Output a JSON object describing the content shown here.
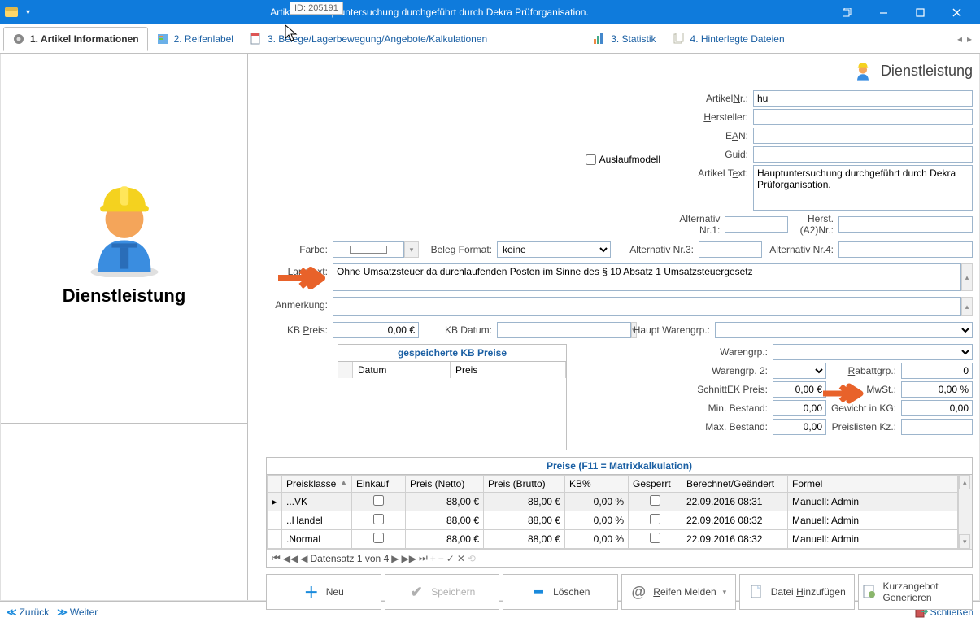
{
  "window": {
    "title": "Artikel hu Hauptuntersuchung durchgeführt durch Dekra Prüforganisation."
  },
  "tabs": {
    "t1": "1. Artikel Informationen",
    "t2": "2. Reifenlabel",
    "t3": "3. Belege/Lagerbewegung/Angebote/Kalkulationen",
    "t4": "3. Statistik",
    "t5": "4. Hinterlegte Dateien"
  },
  "left": {
    "id_label": "ID: 205191",
    "caption": "Dienstleistung"
  },
  "head": {
    "title": "Dienstleistung"
  },
  "labels": {
    "artikelnr": "ArtikelNr.:",
    "hersteller": "Hersteller:",
    "ean": "EAN:",
    "guid": "Guid:",
    "auslauf": "Auslaufmodell",
    "artikeltext": "Artikel Text:",
    "alt1": "Alternativ Nr.1:",
    "herstA2": "Herst. (A2)Nr.:",
    "farbe": "Farbe:",
    "belegformat": "Beleg Format:",
    "alt3": "Alternativ Nr.3:",
    "alt4": "Alternativ Nr.4:",
    "langtext": "Langtext:",
    "anmerkung": "Anmerkung:",
    "kbpreis": "KB Preis:",
    "kbdatum": "KB Datum:",
    "hauptwg": "Haupt Warengrp.:",
    "kbtable": "gespeicherte KB Preise",
    "kb_datum": "Datum",
    "kb_preis": "Preis",
    "wg": "Warengrp.:",
    "wg2": "Warengrp. 2:",
    "rabattgrp": "Rabattgrp.:",
    "schnittek": "SchnittEK Preis:",
    "mwst": "MwSt.:",
    "minbest": "Min. Bestand:",
    "gewicht": "Gewicht in KG:",
    "maxbest": "Max. Bestand:",
    "preislisten": "Preislisten Kz.:",
    "pricehead": "Preise (F11 = Matrixkalkulation)",
    "col_pk": "Preisklasse",
    "col_ek": "Einkauf",
    "col_pn": "Preis (Netto)",
    "col_pb": "Preis (Brutto)",
    "col_kb": "KB%",
    "col_ges": "Gesperrt",
    "col_bg": "Berechnet/Geändert",
    "col_f": "Formel",
    "gridinfo": "Datensatz 1 von 4"
  },
  "values": {
    "artikelnr": "hu",
    "hersteller": "",
    "ean": "",
    "guid": "",
    "artikeltext": "Hauptuntersuchung durchgeführt durch Dekra Prüforganisation.",
    "alt1": "",
    "herstA2": "",
    "belegformat": "keine",
    "alt3": "",
    "alt4": "",
    "langtext": "Ohne Umsatzsteuer da durchlaufenden Posten im Sinne des § 10 Absatz 1 Umsatzsteuergesetz",
    "anmerkung": "",
    "kbpreis": "0,00 €",
    "kbdatum": "",
    "hauptwg": "",
    "wg": "",
    "wg2": "",
    "rabattgrp": "0",
    "schnittek": "0,00 €",
    "mwst": "0,00 %",
    "minbest": "0,00",
    "gewicht": "0,00",
    "maxbest": "0,00",
    "preislisten": ""
  },
  "prices": [
    {
      "pk": "...VK",
      "ek": false,
      "pn": "88,00 €",
      "pb": "88,00 €",
      "kb": "0,00 %",
      "ges": false,
      "bg": "22.09.2016 08:31",
      "f": "Manuell: Admin"
    },
    {
      "pk": "..Handel",
      "ek": false,
      "pn": "88,00 €",
      "pb": "88,00 €",
      "kb": "0,00 %",
      "ges": false,
      "bg": "22.09.2016 08:32",
      "f": "Manuell: Admin"
    },
    {
      "pk": ".Normal",
      "ek": false,
      "pn": "88,00 €",
      "pb": "88,00 €",
      "kb": "0,00 %",
      "ges": false,
      "bg": "22.09.2016 08:32",
      "f": "Manuell: Admin"
    }
  ],
  "actions": {
    "neu": "Neu",
    "speichern": "Speichern",
    "loeschen": "Löschen",
    "reifen": "Reifen Melden",
    "datei": "Datei Hinzufügen",
    "kurz": "Kurzangebot Generieren"
  },
  "footer": {
    "back": "Zurück",
    "fwd": "Weiter",
    "close": "Schließen"
  }
}
